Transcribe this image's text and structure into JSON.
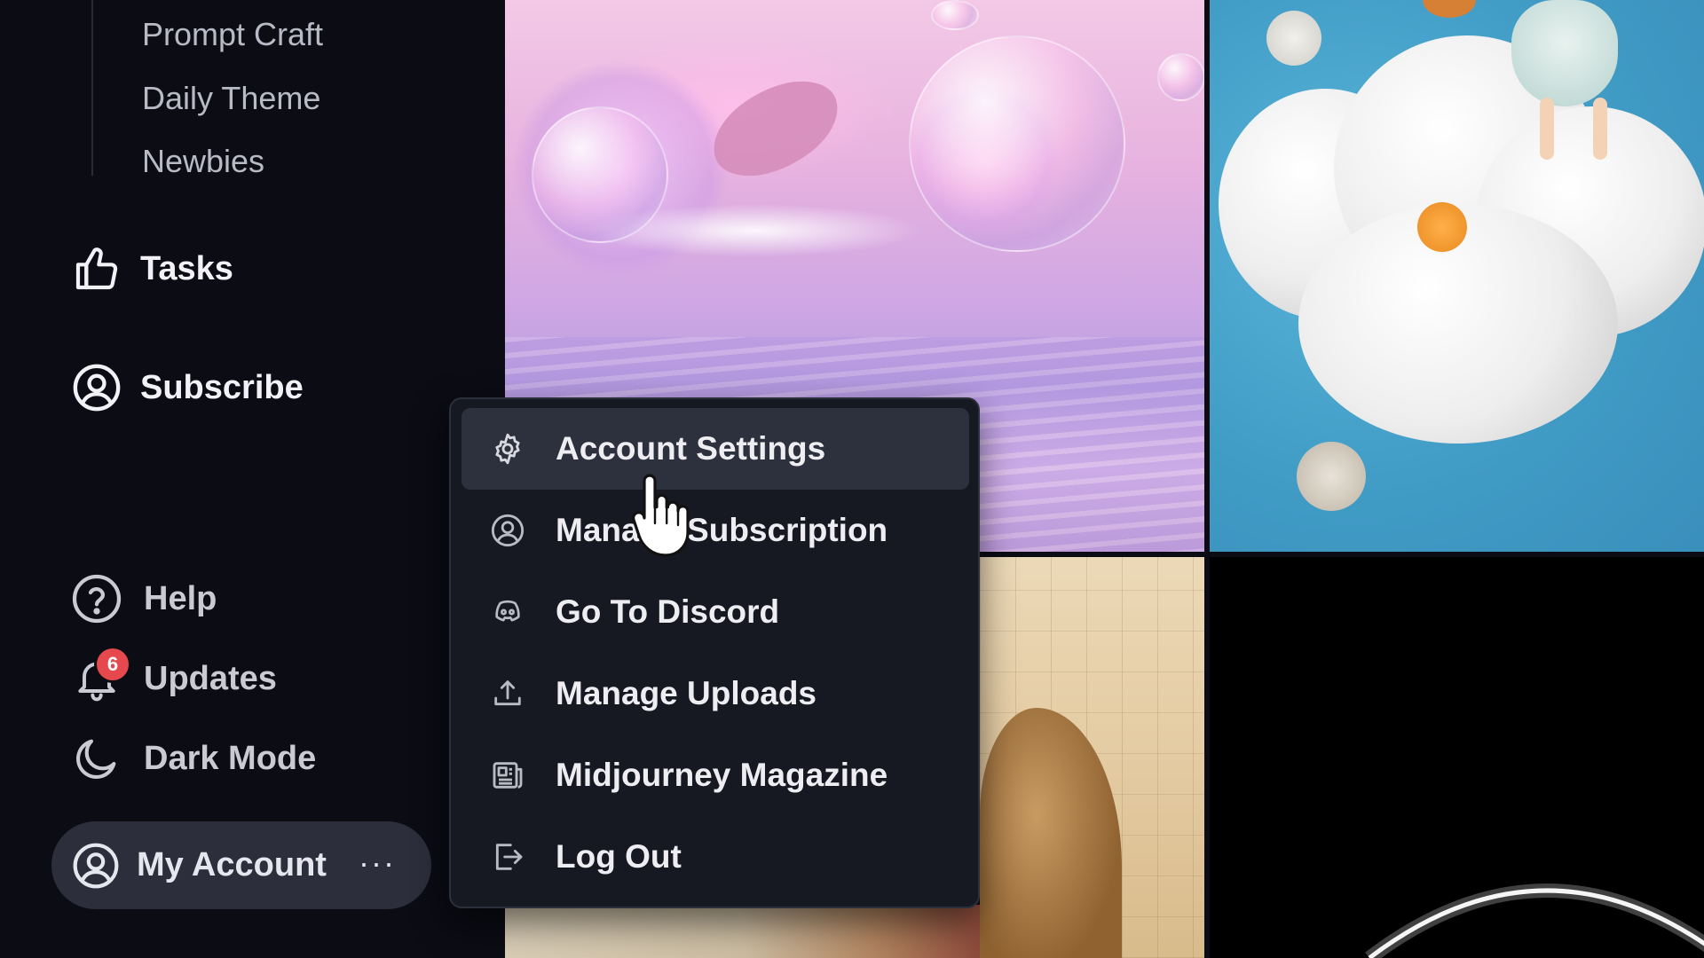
{
  "sidebar": {
    "subnav": [
      "Prompt Craft",
      "Daily Theme",
      "Newbies"
    ],
    "main": [
      {
        "label": "Tasks",
        "icon": "thumbs-up-icon"
      },
      {
        "label": "Subscribe",
        "icon": "user-circle-icon"
      }
    ],
    "secondary": [
      {
        "label": "Help",
        "icon": "help-circle-icon"
      },
      {
        "label": "Updates",
        "icon": "bell-icon",
        "badge": "6"
      },
      {
        "label": "Dark Mode",
        "icon": "moon-icon"
      }
    ],
    "account": {
      "label": "My Account",
      "icon": "user-circle-icon",
      "more": "···"
    }
  },
  "menu": {
    "items": [
      {
        "label": "Account Settings",
        "icon": "gear-icon",
        "active": true
      },
      {
        "label": "Manage Subscription",
        "icon": "user-circle-icon"
      },
      {
        "label": "Go To Discord",
        "icon": "discord-icon"
      },
      {
        "label": "Manage Uploads",
        "icon": "upload-icon"
      },
      {
        "label": "Midjourney Magazine",
        "icon": "magazine-icon"
      },
      {
        "label": "Log Out",
        "icon": "logout-icon"
      }
    ]
  },
  "colors": {
    "background": "#0b0c14",
    "menu_bg": "#171922",
    "active_item": "#2d303d",
    "badge": "#e5484d"
  }
}
